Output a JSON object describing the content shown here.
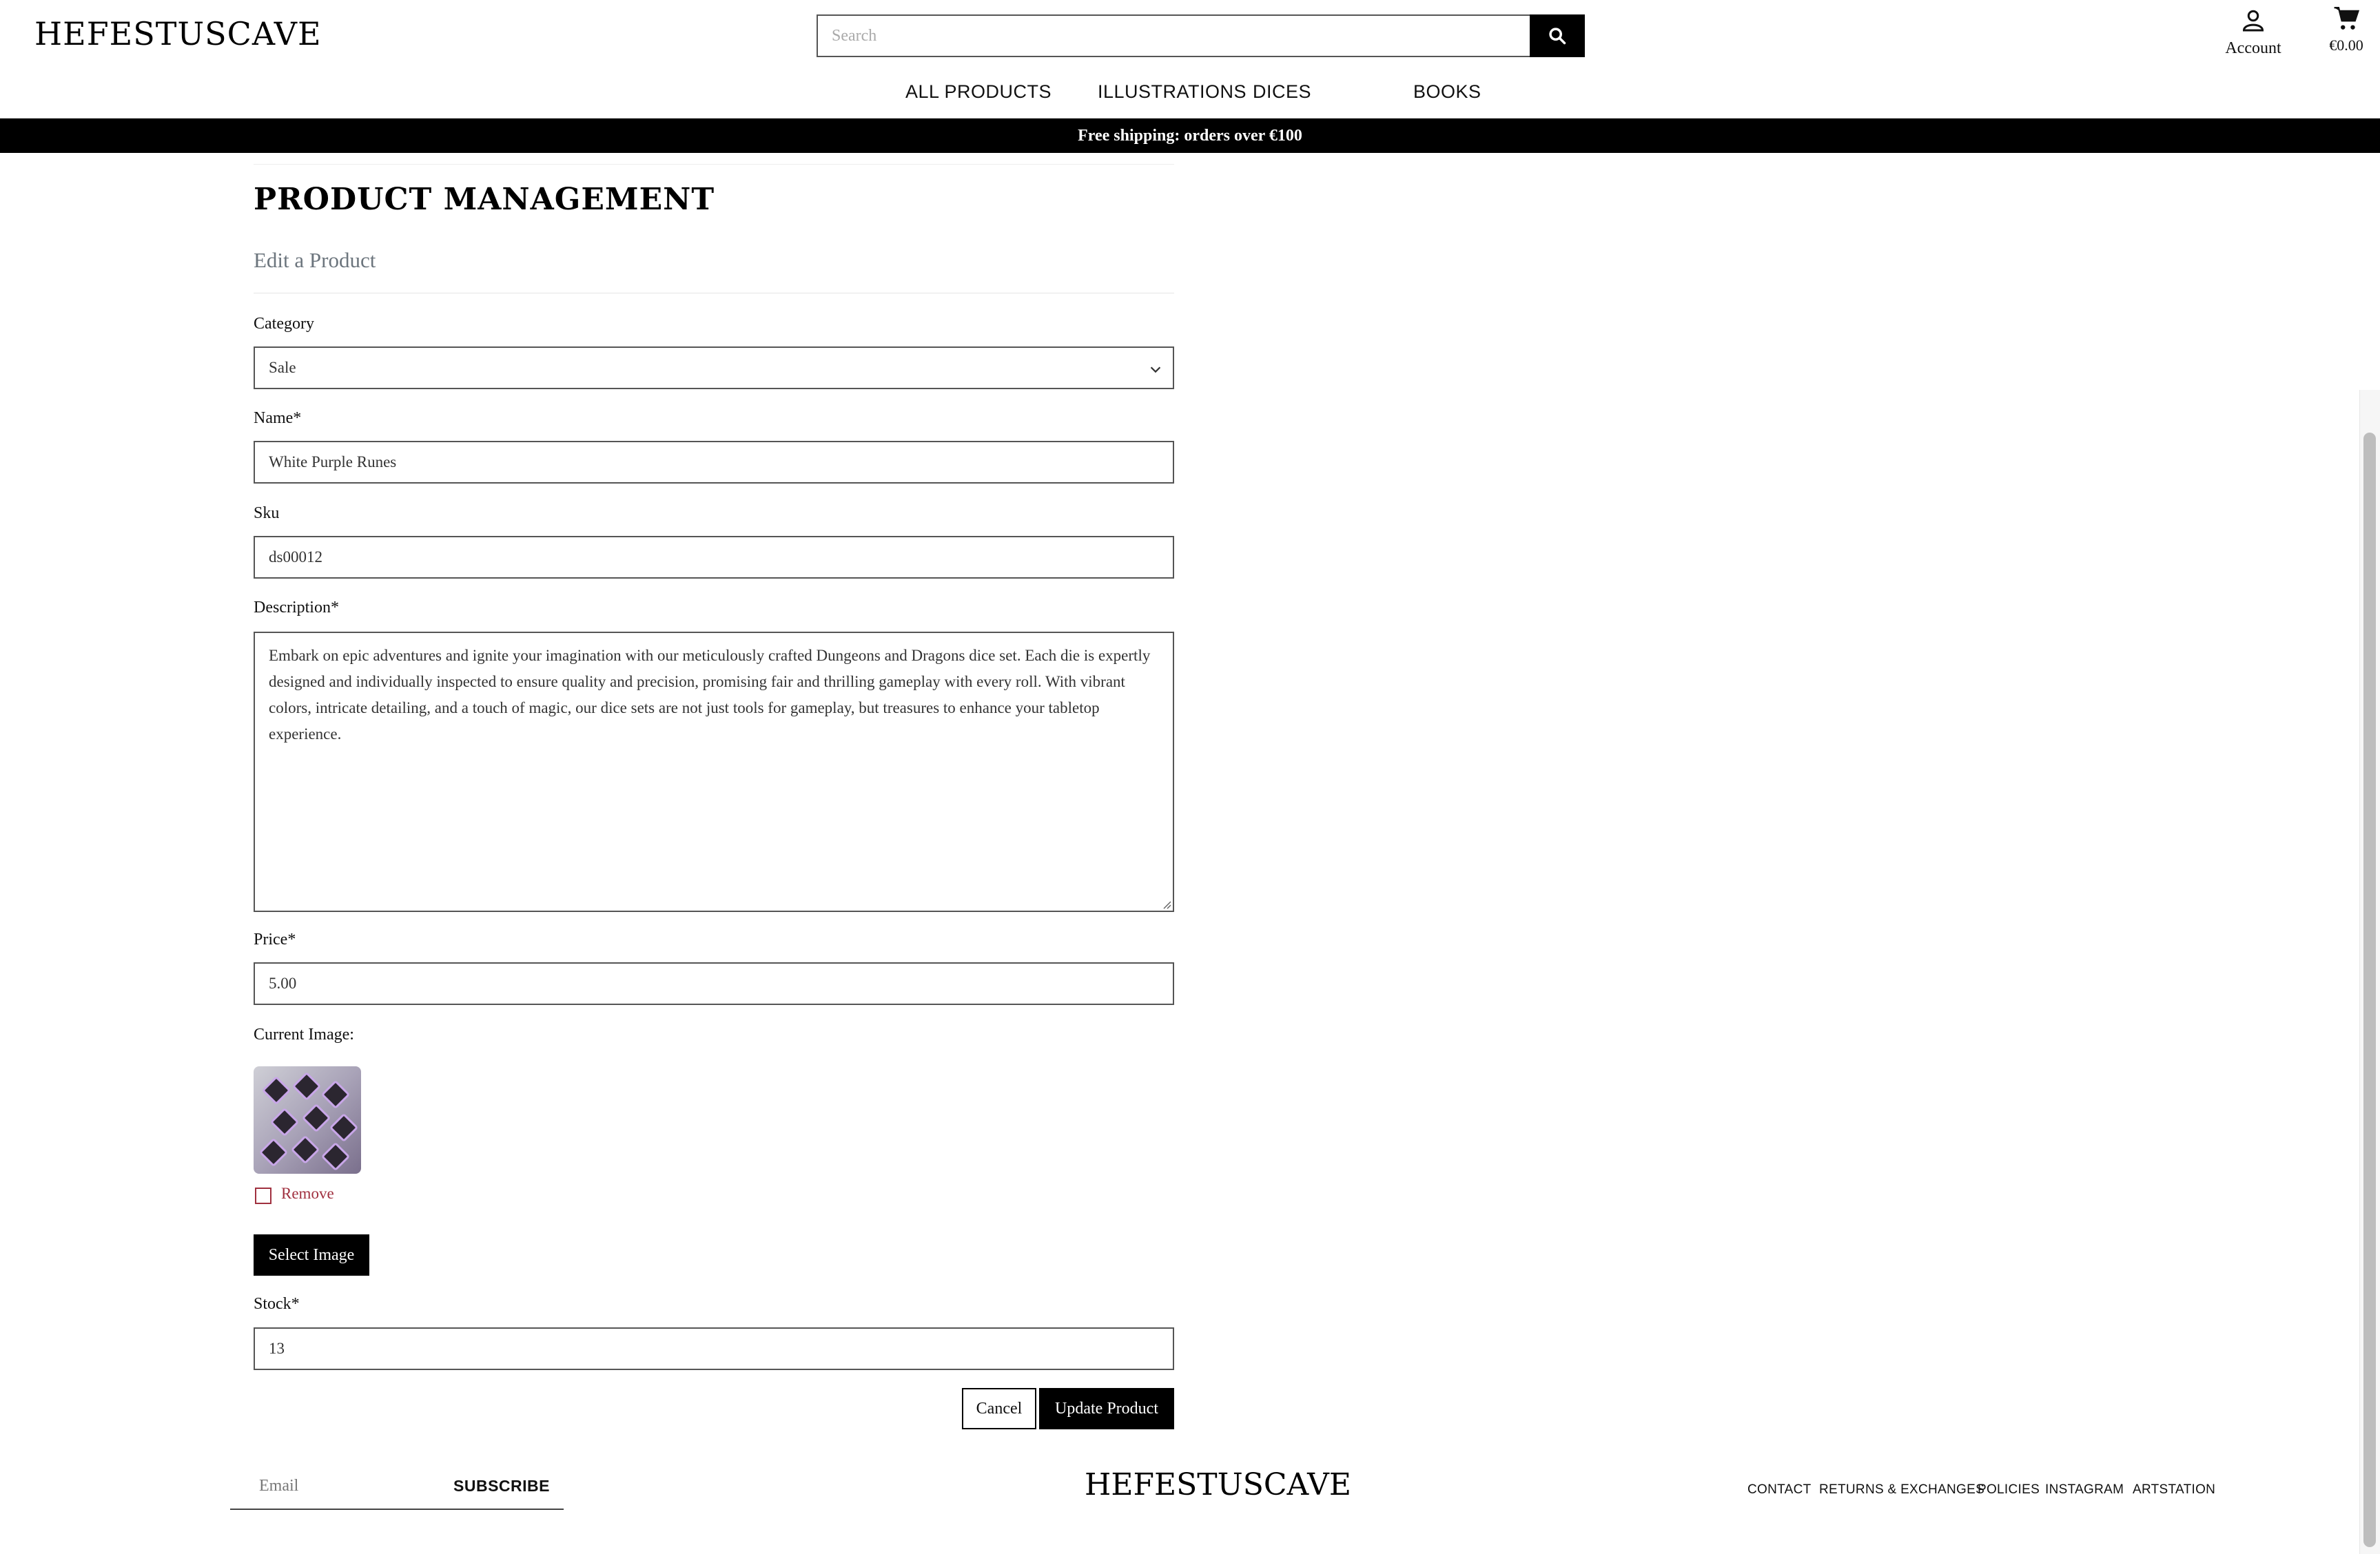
{
  "header": {
    "logo": "HEFESTUSCAVE",
    "search_placeholder": "Search",
    "account_label": "Account",
    "cart_total": "€0.00",
    "nav": [
      "ALL PRODUCTS",
      "ILLUSTRATIONS",
      "DICES",
      "BOOKS"
    ]
  },
  "banner": "Free shipping: orders over €100",
  "main": {
    "title": "PRODUCT MANAGEMENT",
    "subtitle": "Edit a Product",
    "category": {
      "label": "Category",
      "value": "Sale"
    },
    "name": {
      "label": "Name*",
      "value": "White Purple Runes"
    },
    "sku": {
      "label": "Sku",
      "value": "ds00012"
    },
    "description": {
      "label": "Description*",
      "value": "Embark on epic adventures and ignite your imagination with our meticulously crafted Dungeons and Dragons dice set. Each die is expertly designed and individually inspected to ensure quality and precision, promising fair and thrilling gameplay with every roll. With vibrant colors, intricate detailing, and a touch of magic, our dice sets are not just tools for gameplay, but treasures to enhance your tabletop experience."
    },
    "price": {
      "label": "Price*",
      "value": "5.00"
    },
    "current_image_label": "Current Image:",
    "remove_label": "Remove",
    "select_image_label": "Select Image",
    "stock": {
      "label": "Stock*",
      "value": "13"
    },
    "cancel_label": "Cancel",
    "update_label": "Update Product"
  },
  "footer": {
    "email_placeholder": "Email",
    "subscribe_label": "SUBSCRIBE",
    "logo": "HEFESTUSCAVE",
    "links": [
      "CONTACT",
      "RETURNS & EXCHANGES",
      "POLICIES",
      "INSTAGRAM",
      "ARTSTATION"
    ]
  },
  "colors": {
    "accent": "#000000",
    "remove": "#a0303f",
    "muted": "#6c757d"
  }
}
